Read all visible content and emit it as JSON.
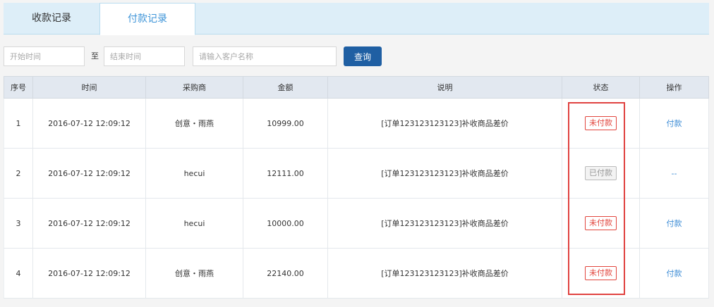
{
  "tabs": [
    {
      "label": "收款记录"
    },
    {
      "label": "付款记录"
    }
  ],
  "filter": {
    "start_placeholder": "开始时间",
    "to_label": "至",
    "end_placeholder": "结束时间",
    "customer_placeholder": "请输入客户名称",
    "query_label": "查询"
  },
  "table": {
    "headers": [
      "序号",
      "时间",
      "采购商",
      "金额",
      "说明",
      "状态",
      "操作"
    ],
    "rows": [
      {
        "index": "1",
        "time": "2016-07-12  12:09:12",
        "buyer": "创意・雨燕",
        "amount": "10999.00",
        "desc": "[订单123123123123]补收商品差价",
        "status": "未付款",
        "status_type": "unpaid",
        "action": "付款"
      },
      {
        "index": "2",
        "time": "2016-07-12  12:09:12",
        "buyer": "hecui",
        "amount": "12111.00",
        "desc": "[订单123123123123]补收商品差价",
        "status": "已付款",
        "status_type": "paid",
        "action": "--"
      },
      {
        "index": "3",
        "time": "2016-07-12  12:09:12",
        "buyer": "hecui",
        "amount": "10000.00",
        "desc": "[订单123123123123]补收商品差价",
        "status": "未付款",
        "status_type": "unpaid",
        "action": "付款"
      },
      {
        "index": "4",
        "time": "2016-07-12  12:09:12",
        "buyer": "创意・雨燕",
        "amount": "22140.00",
        "desc": "[订单123123123123]补收商品差价",
        "status": "未付款",
        "status_type": "unpaid",
        "action": "付款"
      }
    ]
  },
  "colors": {
    "active_tab_text": "#3f95d8",
    "query_button": "#1f5fa3",
    "unpaid": "#e2463e",
    "link": "#3f8ed6",
    "highlight": "#e04240"
  }
}
